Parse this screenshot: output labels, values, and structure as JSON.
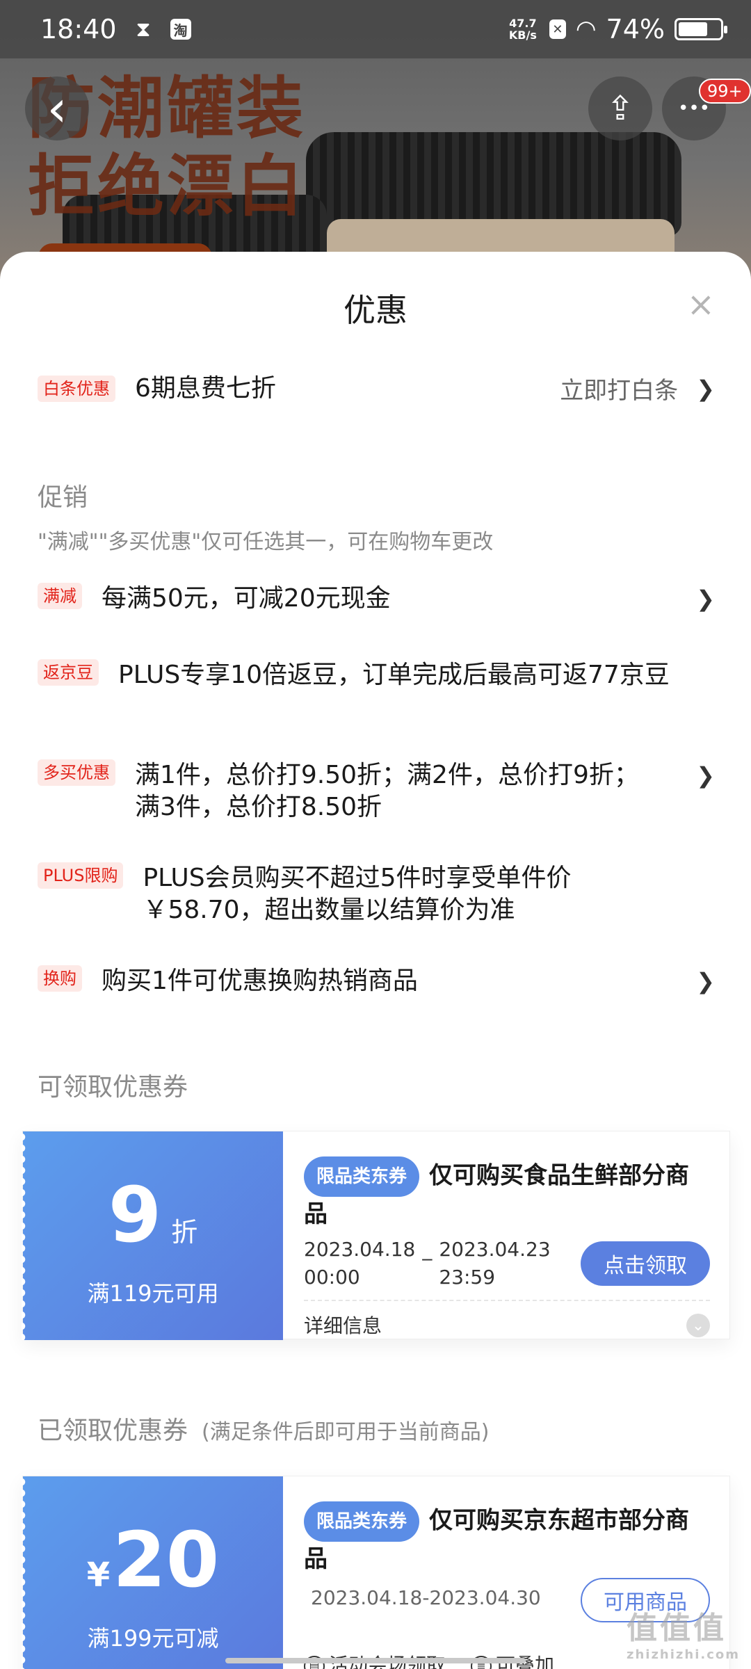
{
  "status_bar": {
    "time": "18:40",
    "speed_top": "47.7",
    "speed_bottom": "KB/s",
    "battery": "74%",
    "battery_level": 0.74,
    "app_icon": "淘"
  },
  "banner": {
    "line1": "防潮罐装",
    "line2": "拒绝漂白"
  },
  "top_buttons": {
    "back_icon": "‹",
    "share_icon": "⇪",
    "more_icon": "•••",
    "more_badge": "99+"
  },
  "sheet": {
    "title": "优惠",
    "close_icon": "×"
  },
  "baitiao": {
    "tag": "白条优惠",
    "text": "6期息费七折",
    "link": "立即打白条",
    "chev": "❯"
  },
  "promo": {
    "title": "促销",
    "note": "\"满减\"\"多买优惠\"仅可任选其一，可在购物车更改",
    "items": [
      {
        "tag": "满减",
        "text": "每满50元，可减20元现金",
        "chev": "❯"
      },
      {
        "tag": "返京豆",
        "text": "PLUS专享10倍返豆，订单完成后最高可返77京豆",
        "chev": ""
      },
      {
        "tag": "多买优惠",
        "text": "满1件，总价打9.50折；满2件，总价打9折；满3件，总价打8.50折",
        "chev": "❯"
      },
      {
        "tag": "PLUS限购",
        "text": "PLUS会员购买不超过5件时享受单件价￥58.70，超出数量以结算价为准",
        "chev": ""
      },
      {
        "tag": "换购",
        "text": "购买1件可优惠换购热销商品",
        "chev": "❯"
      }
    ]
  },
  "available": {
    "title": "可领取优惠券",
    "coupon": {
      "value": "9",
      "unit": "折",
      "condition": "满119元可用",
      "tag": "限品类东券",
      "name": "仅可购买食品生鲜部分商品",
      "date_start": "2023.04.18",
      "time_start": "00:00",
      "date_sep": "_",
      "date_end": "2023.04.23",
      "time_end": "23:59",
      "button": "点击领取",
      "detail": "详细信息",
      "detail_icon": "⌄"
    }
  },
  "received": {
    "title": "已领取优惠券",
    "note": "(满足条件后即可用于当前商品)",
    "coupon": {
      "currency": "¥",
      "value": "20",
      "condition": "满199元可减",
      "tag": "限品类东券",
      "name": "仅可购买京东超市部分商品",
      "range": "2023.04.18-2023.04.30",
      "button": "可用商品",
      "foot1": "活动会场领取",
      "foot2": "可叠加"
    }
  },
  "watermark": {
    "main": "值值值",
    "sub": "zhizhizhi.com"
  }
}
